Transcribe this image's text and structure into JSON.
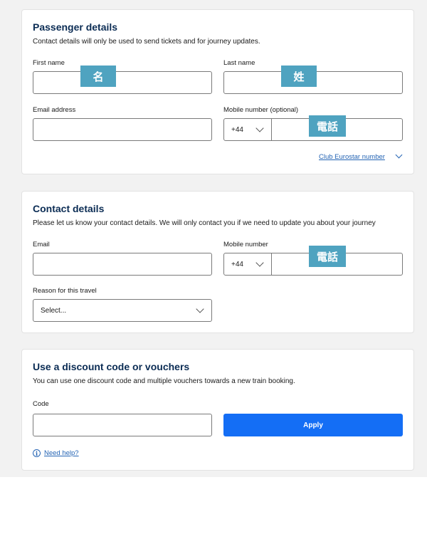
{
  "passenger": {
    "title": "Passenger details",
    "description": "Contact details will only be used to send tickets and for journey updates.",
    "first_name_label": "First name",
    "first_name_tag": "名",
    "last_name_label": "Last name",
    "last_name_tag": "姓",
    "email_label": "Email address",
    "mobile_label": "Mobile number (optional)",
    "country_code": "+44",
    "phone_tag": "電話",
    "club_link": "Club Eurostar number"
  },
  "contact": {
    "title": "Contact details",
    "description": "Please let us know your contact details. We will only contact you if we need to update you about your journey",
    "email_label": "Email",
    "mobile_label": "Mobile number",
    "country_code": "+44",
    "phone_tag": "電話",
    "reason_label": "Reason for this travel",
    "reason_selected": "Select..."
  },
  "discount": {
    "title": "Use a discount code or vouchers",
    "description": "You can use one discount code and multiple vouchers towards a new train booking.",
    "code_label": "Code",
    "apply_label": "Apply",
    "help_link": "Need help?",
    "info_glyph": "i"
  },
  "colors": {
    "heading": "#0b2c54",
    "accent_button": "#146ef5",
    "link": "#2464b4",
    "tag_bg": "#4fa3c0"
  }
}
